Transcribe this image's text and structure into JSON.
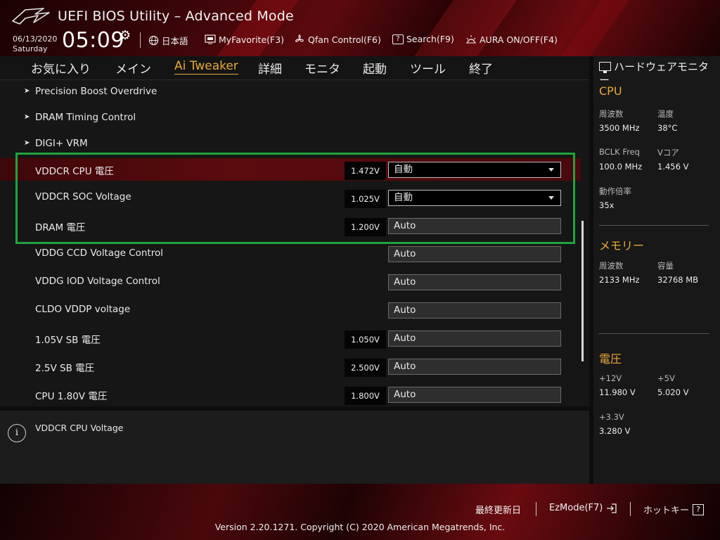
{
  "header": {
    "title": "UEFI BIOS Utility – Advanced Mode",
    "date": "06/13/2020",
    "day": "Saturday",
    "time": "05:09",
    "items": [
      {
        "icon": "globe-icon",
        "label": "日本語"
      },
      {
        "icon": "myfavorite-icon",
        "label": "MyFavorite(F3)"
      },
      {
        "icon": "fan-icon",
        "label": "Qfan Control(F6)"
      },
      {
        "icon": "question-icon",
        "label": "Search(F9)"
      },
      {
        "icon": "aura-icon",
        "label": "AURA ON/OFF(F4)"
      }
    ]
  },
  "tabs": [
    {
      "label": "お気に入り"
    },
    {
      "label": "メイン"
    },
    {
      "label": "Ai Tweaker",
      "active": true
    },
    {
      "label": "詳細"
    },
    {
      "label": "モニタ"
    },
    {
      "label": "起動"
    },
    {
      "label": "ツール"
    },
    {
      "label": "終了"
    }
  ],
  "settings": [
    {
      "label": "Precision Boost Overdrive",
      "submenu": true
    },
    {
      "label": "DRAM Timing Control",
      "submenu": true
    },
    {
      "label": "DIGI+ VRM",
      "submenu": true
    },
    {
      "label": "VDDCR CPU 電圧",
      "value": "1.472V",
      "field": "自動",
      "dropdown": true,
      "selected": true
    },
    {
      "label": "VDDCR SOC Voltage",
      "value": "1.025V",
      "field": "自動",
      "dropdown": true
    },
    {
      "label": "DRAM 電圧",
      "value": "1.200V",
      "field": "Auto"
    },
    {
      "label": "VDDG CCD Voltage Control",
      "field": "Auto"
    },
    {
      "label": "VDDG IOD Voltage Control",
      "field": "Auto"
    },
    {
      "label": "CLDO VDDP voltage",
      "field": "Auto"
    },
    {
      "label": "1.05V SB 電圧",
      "value": "1.050V",
      "field": "Auto"
    },
    {
      "label": "2.5V SB 電圧",
      "value": "2.500V",
      "field": "Auto"
    },
    {
      "label": "CPU 1.80V 電圧",
      "value": "1.800V",
      "field": "Auto"
    }
  ],
  "help": {
    "text": "VDDCR CPU Voltage"
  },
  "hw_monitor": {
    "title": "ハードウェアモニター",
    "cpu": {
      "title": "CPU",
      "freq_label": "周波数",
      "freq": "3500 MHz",
      "temp_label": "温度",
      "temp": "38°C",
      "bclk_label": "BCLK Freq",
      "bclk": "100.0 MHz",
      "vcore_label": "Vコア",
      "vcore": "1.456 V",
      "ratio_label": "動作倍率",
      "ratio": "35x"
    },
    "memory": {
      "title": "メモリー",
      "freq_label": "周波数",
      "freq": "2133 MHz",
      "cap_label": "容量",
      "cap": "32768 MB"
    },
    "voltage": {
      "title": "電圧",
      "v12_label": "+12V",
      "v12": "11.980 V",
      "v5_label": "+5V",
      "v5": "5.020 V",
      "v33_label": "+3.3V",
      "v33": "3.280 V"
    }
  },
  "footer": {
    "last_modified": "最終更新日",
    "ezmode": "EzMode(F7)",
    "hotkeys": "ホットキー",
    "version": "Version 2.20.1271. Copyright (C) 2020 American Megatrends, Inc."
  }
}
